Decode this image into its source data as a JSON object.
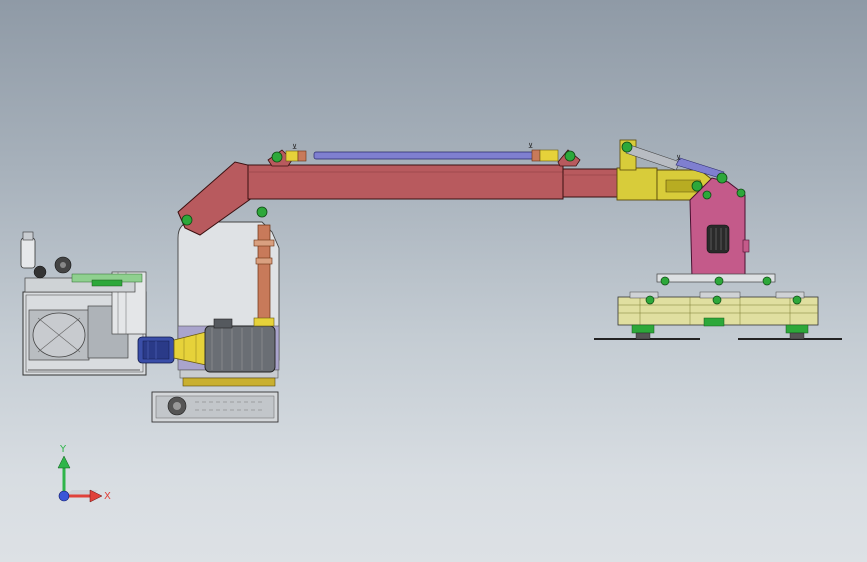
{
  "viewport": {
    "background_top": "#8f9aa6",
    "background_bottom": "#dde1e5"
  },
  "model": {
    "boom_color": "#b85a5e",
    "bracket_color": "#d8cc3a",
    "column_color": "#c45a8a",
    "cylinder_rod_color": "#7f7fd0",
    "pin_color": "#2da83a",
    "motor_color": "#6a6e74",
    "coupling_color": "#e6d23a",
    "pump_color": "#3a4ea8"
  },
  "triad": {
    "y_label": "Y",
    "x_label": "X",
    "y_color": "#2fb54a",
    "x_color": "#e0413a",
    "z_color": "#3a56d8"
  }
}
